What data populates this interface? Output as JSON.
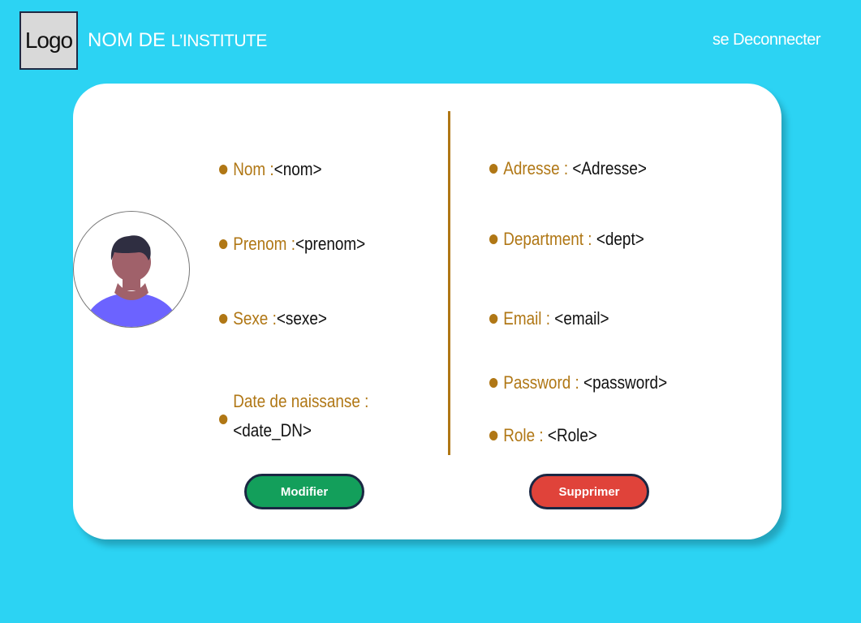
{
  "header": {
    "logo": "Logo",
    "institute_part1": "NOM DE",
    "institute_part2": "L’INSTITUTE",
    "logout": "se Deconnecter"
  },
  "profile": {
    "left_fields": [
      {
        "label": "Nom :",
        "value": "<nom>"
      },
      {
        "label": "Prenom :",
        "value": "<prenom>"
      },
      {
        "label": "Sexe :",
        "value": "<sexe>"
      },
      {
        "label": "Date de naissanse :",
        "value": "<date_DN>"
      }
    ],
    "right_fields": [
      {
        "label": "Adresse : ",
        "value": "<Adresse>"
      },
      {
        "label": "Department : ",
        "value": "<dept>"
      },
      {
        "label": "Email : ",
        "value": "<email>"
      },
      {
        "label": "Password : ",
        "value": "<password>"
      },
      {
        "label": "Role : ",
        "value": "<Role>"
      }
    ]
  },
  "actions": {
    "modify": "Modifier",
    "delete": "Supprimer"
  },
  "colors": {
    "background": "#2cd3f3",
    "accent": "#b07715",
    "modify": "#139f5b",
    "delete": "#e0433a"
  },
  "icons": {
    "avatar": "user-avatar-icon"
  }
}
